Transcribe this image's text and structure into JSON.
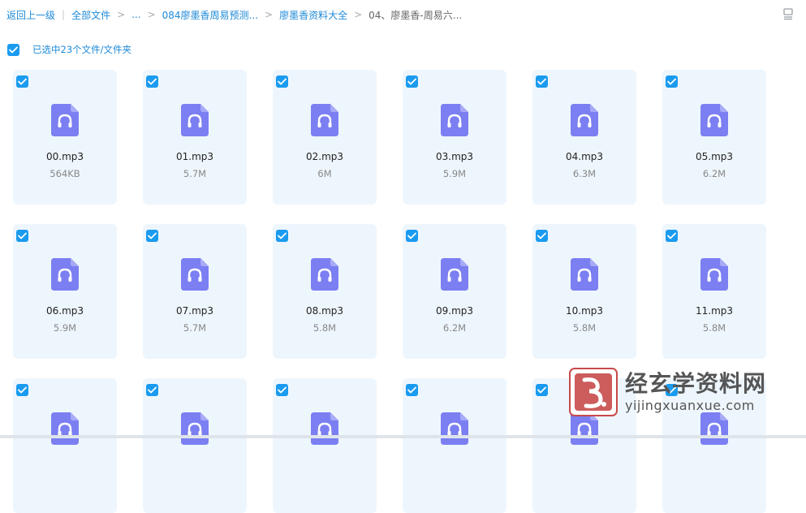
{
  "breadcrumb": {
    "back_label": "返回上一级",
    "separator": "|",
    "items": [
      {
        "label": "全部文件"
      },
      {
        "label": "..."
      },
      {
        "label": "084廖墨香周易预测..."
      },
      {
        "label": "廖墨香资料大全"
      },
      {
        "label": "04、廖墨香-周易六..."
      }
    ]
  },
  "toolbar": {
    "view_toggle_icon": "list-view-icon"
  },
  "selection": {
    "label": "已选中23个文件/文件夹",
    "checked": true
  },
  "files": [
    {
      "name": "00.mp3",
      "size": "564KB"
    },
    {
      "name": "01.mp3",
      "size": "5.7M"
    },
    {
      "name": "02.mp3",
      "size": "6M"
    },
    {
      "name": "03.mp3",
      "size": "5.9M"
    },
    {
      "name": "04.mp3",
      "size": "6.3M"
    },
    {
      "name": "05.mp3",
      "size": "6.2M"
    },
    {
      "name": "06.mp3",
      "size": "5.9M"
    },
    {
      "name": "07.mp3",
      "size": "5.7M"
    },
    {
      "name": "08.mp3",
      "size": "5.8M"
    },
    {
      "name": "09.mp3",
      "size": "6.2M"
    },
    {
      "name": "10.mp3",
      "size": "5.8M"
    },
    {
      "name": "11.mp3",
      "size": "5.8M"
    },
    {
      "name": "",
      "size": ""
    },
    {
      "name": "",
      "size": ""
    },
    {
      "name": "",
      "size": ""
    },
    {
      "name": "",
      "size": ""
    },
    {
      "name": "",
      "size": ""
    },
    {
      "name": "",
      "size": ""
    }
  ],
  "file_icon": "audio-file-icon",
  "watermark": {
    "title": "经玄学资料网",
    "url": "yijingxuanxue.com"
  },
  "colors": {
    "accent": "#1a9bf0",
    "link": "#1f8ad8",
    "card_bg": "#eef6fd",
    "icon_purple": "#7b7ff2"
  }
}
